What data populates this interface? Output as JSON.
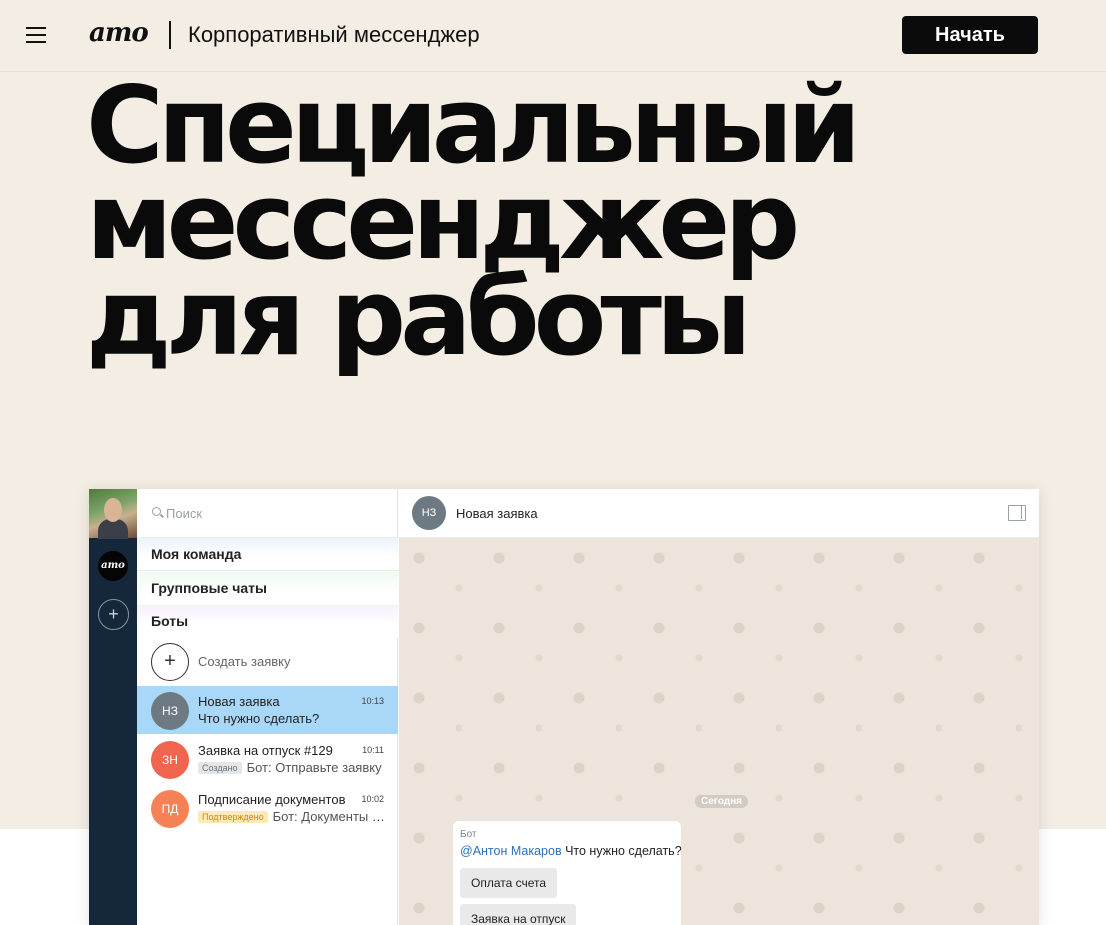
{
  "header": {
    "logo": "amo",
    "subtitle": "Корпоративный мессенджер",
    "cta": "Начать"
  },
  "hero": {
    "lines": [
      "Специальный",
      "мессенджер",
      "для работы"
    ]
  },
  "app": {
    "rail": {
      "brand": "amo"
    },
    "search": {
      "placeholder": "Поиск"
    },
    "sections": [
      "Моя команда",
      "Групповые чаты",
      "Боты"
    ],
    "create_label": "Создать заявку",
    "chats": [
      {
        "initials": "НЗ",
        "name": "Новая заявка",
        "time": "10:13",
        "badge": "",
        "message": "Что нужно сделать?",
        "avatar_color": "#6e7a83",
        "active": true
      },
      {
        "initials": "ЗН",
        "name": "Заявка на отпуск #129",
        "time": "10:11",
        "badge": "Создано",
        "message": "Бот: Отправьте заявку",
        "avatar_color": "#f0654f",
        "active": false
      },
      {
        "initials": "ПД",
        "name": "Подписание документов",
        "time": "10:02",
        "badge": "Подтверждено",
        "message": "Бот: Документы в работе",
        "avatar_color": "#f58257",
        "active": false
      }
    ],
    "chat": {
      "title": "Новая заявка",
      "initials": "НЗ",
      "date_label": "Сегодня",
      "message": {
        "author": "Бот",
        "mention": "@Антон Макаров",
        "text": "Что нужно сделать?",
        "buttons": [
          "Оплата счета",
          "Заявка на отпуск"
        ]
      }
    }
  },
  "colors": {
    "hero_bg": "#f3ede4",
    "rail_bg": "#15273b",
    "active_chat": "#a9d7f8",
    "cta_bg": "#0b0b0b"
  }
}
